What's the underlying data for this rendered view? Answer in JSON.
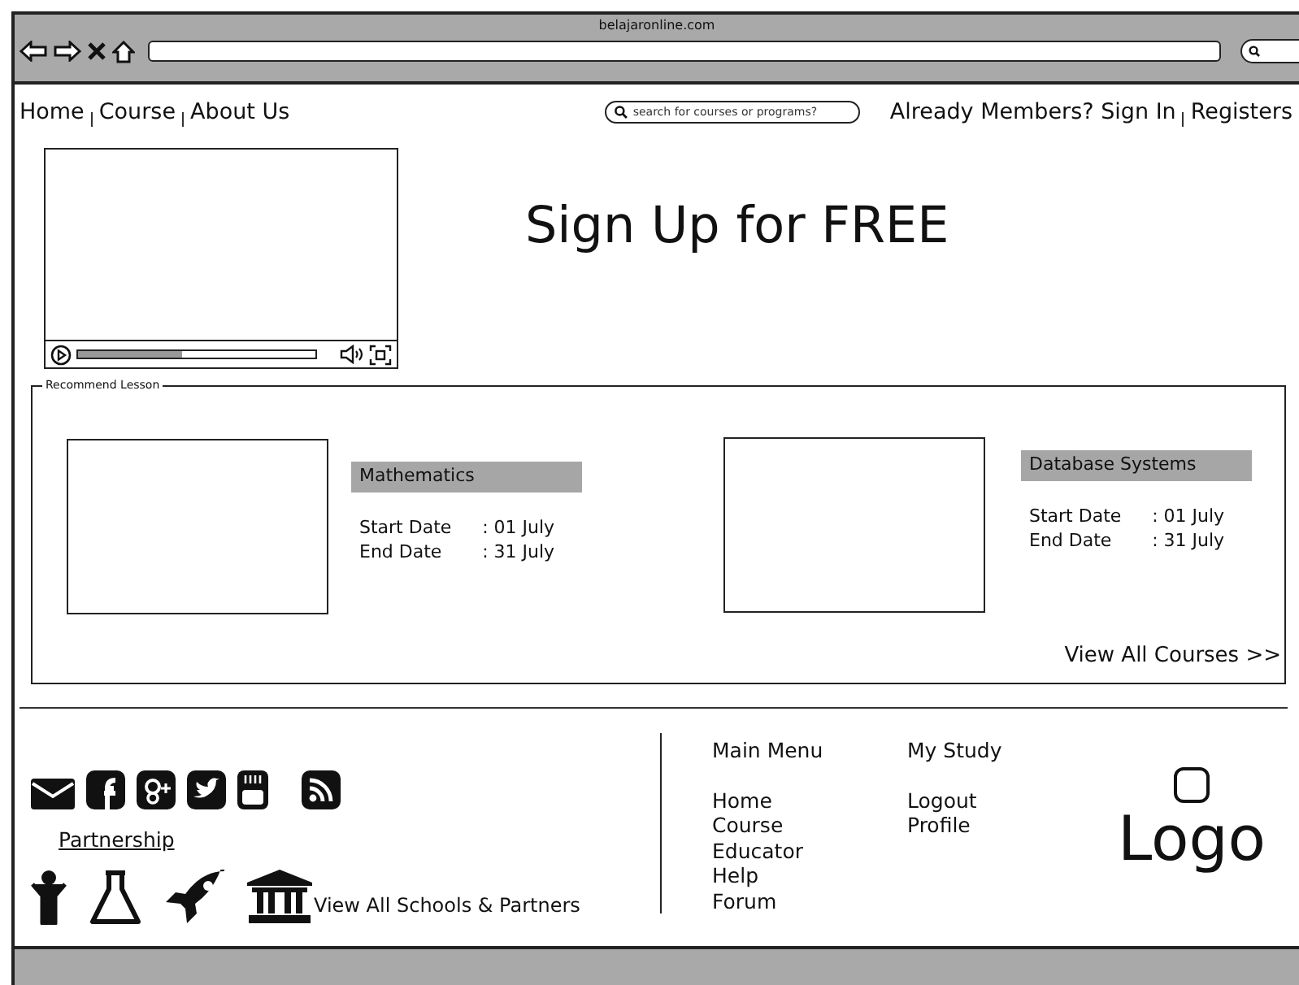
{
  "browser": {
    "address": "belajaronline.com"
  },
  "nav": {
    "left_links": [
      "Home",
      "Course",
      "About Us"
    ],
    "search": {
      "placeholder": "search for courses or programs?"
    },
    "right_links": [
      "Already Members? Sign In",
      "Registers"
    ]
  },
  "hero": {
    "video": {
      "level": 0.44
    },
    "title": "Sign Up for FREE"
  },
  "recommend": {
    "legend": "Recommend Lesson",
    "courses": [
      {
        "title": "Mathematics",
        "dates": [
          {
            "label": "Start Date",
            "value": ": 01 July"
          },
          {
            "label": "End Date",
            "value": ": 31 July"
          }
        ]
      },
      {
        "title": "Database Systems",
        "dates": [
          {
            "label": "Start Date",
            "value": ": 01 July"
          },
          {
            "label": "End Date",
            "value": ": 31 July"
          }
        ]
      }
    ],
    "view_all": "View All Courses >>"
  },
  "footer": {
    "partnership": "Partnership",
    "view_all_partners": "View All Schools & Partners",
    "menus": [
      {
        "title": "Main Menu",
        "items": [
          "Home",
          "Course",
          "Educator",
          "Help",
          "Forum"
        ]
      },
      {
        "title": "My Study",
        "items": [
          "Logout",
          "Profile"
        ]
      }
    ],
    "logo": "Logo"
  }
}
